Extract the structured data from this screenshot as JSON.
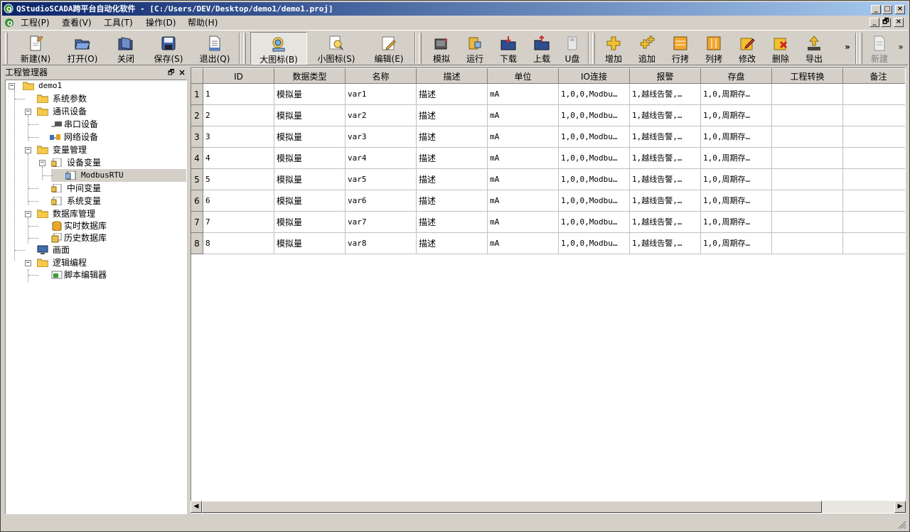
{
  "window": {
    "title": "QStudioSCADA跨平台自动化软件 - [C:/Users/DEV/Desktop/demo1/demo1.proj]",
    "caption_minimize": "_",
    "caption_maximize": "□",
    "caption_close": "×",
    "mdi_minimize": "_",
    "mdi_restore": "🗗",
    "mdi_close": "×"
  },
  "menu": [
    {
      "label": "工程(P)"
    },
    {
      "label": "查看(V)"
    },
    {
      "label": "工具(T)"
    },
    {
      "label": "操作(D)"
    },
    {
      "label": "帮助(H)"
    }
  ],
  "toolbar": {
    "new_label": "新建(N)",
    "open_label": "打开(O)",
    "close_label": "关闭",
    "save_label": "保存(S)",
    "exit_label": "退出(Q)",
    "bigicon_label": "大图标(B)",
    "smallicon_label": "小图标(S)",
    "edit_label": "编辑(E)",
    "simulate_label": "模拟",
    "run_label": "运行",
    "download_label": "下载",
    "upload_label": "上载",
    "udisk_label": "U盘",
    "add_label": "增加",
    "append_label": "追加",
    "rowcopy_label": "行拷",
    "colcopy_label": "列拷",
    "modify_label": "修改",
    "delete_label": "删除",
    "export_label": "导出",
    "overflow1": "»",
    "new2_label": "新建",
    "overflow2": "»"
  },
  "project_panel": {
    "title": "工程管理器",
    "float_btn": "🗗",
    "close_btn": "×",
    "tree": [
      {
        "label": "demo1"
      },
      {
        "label": "系统参数"
      },
      {
        "label": "通讯设备"
      },
      {
        "label": "串口设备"
      },
      {
        "label": "网络设备"
      },
      {
        "label": "变量管理"
      },
      {
        "label": "设备变量"
      },
      {
        "label": "ModbusRTU"
      },
      {
        "label": "中间变量"
      },
      {
        "label": "系统变量"
      },
      {
        "label": "数据库管理"
      },
      {
        "label": "实时数据库"
      },
      {
        "label": "历史数据库"
      },
      {
        "label": "画面"
      },
      {
        "label": "逻辑编程"
      },
      {
        "label": "脚本编辑器"
      }
    ]
  },
  "table": {
    "columns": [
      "ID",
      "数据类型",
      "名称",
      "描述",
      "单位",
      "IO连接",
      "报警",
      "存盘",
      "工程转换",
      "备注"
    ],
    "rows": [
      {
        "num": "1",
        "cells": [
          "1",
          "模拟量",
          "var1",
          "描述",
          "mA",
          "1,0,0,Modbu…",
          "1,越线告警,…",
          "1,0,周期存…",
          "",
          ""
        ]
      },
      {
        "num": "2",
        "cells": [
          "2",
          "模拟量",
          "var2",
          "描述",
          "mA",
          "1,0,0,Modbu…",
          "1,越线告警,…",
          "1,0,周期存…",
          "",
          ""
        ]
      },
      {
        "num": "3",
        "cells": [
          "3",
          "模拟量",
          "var3",
          "描述",
          "mA",
          "1,0,0,Modbu…",
          "1,越线告警,…",
          "1,0,周期存…",
          "",
          ""
        ]
      },
      {
        "num": "4",
        "cells": [
          "4",
          "模拟量",
          "var4",
          "描述",
          "mA",
          "1,0,0,Modbu…",
          "1,越线告警,…",
          "1,0,周期存…",
          "",
          ""
        ]
      },
      {
        "num": "5",
        "cells": [
          "5",
          "模拟量",
          "var5",
          "描述",
          "mA",
          "1,0,0,Modbu…",
          "1,越线告警,…",
          "1,0,周期存…",
          "",
          ""
        ]
      },
      {
        "num": "6",
        "cells": [
          "6",
          "模拟量",
          "var6",
          "描述",
          "mA",
          "1,0,0,Modbu…",
          "1,越线告警,…",
          "1,0,周期存…",
          "",
          ""
        ]
      },
      {
        "num": "7",
        "cells": [
          "7",
          "模拟量",
          "var7",
          "描述",
          "mA",
          "1,0,0,Modbu…",
          "1,越线告警,…",
          "1,0,周期存…",
          "",
          ""
        ]
      },
      {
        "num": "8",
        "cells": [
          "8",
          "模拟量",
          "var8",
          "描述",
          "mA",
          "1,0,0,Modbu…",
          "1,越线告警,…",
          "1,0,周期存…",
          "",
          ""
        ]
      }
    ]
  },
  "scrollbar": {
    "left_arrow": "◀",
    "right_arrow": "▶"
  },
  "colors": {
    "title_gradient_start": "#0a246a",
    "title_gradient_end": "#a6caf0",
    "face": "#d4d0c8",
    "folder": "#f4c94c"
  }
}
